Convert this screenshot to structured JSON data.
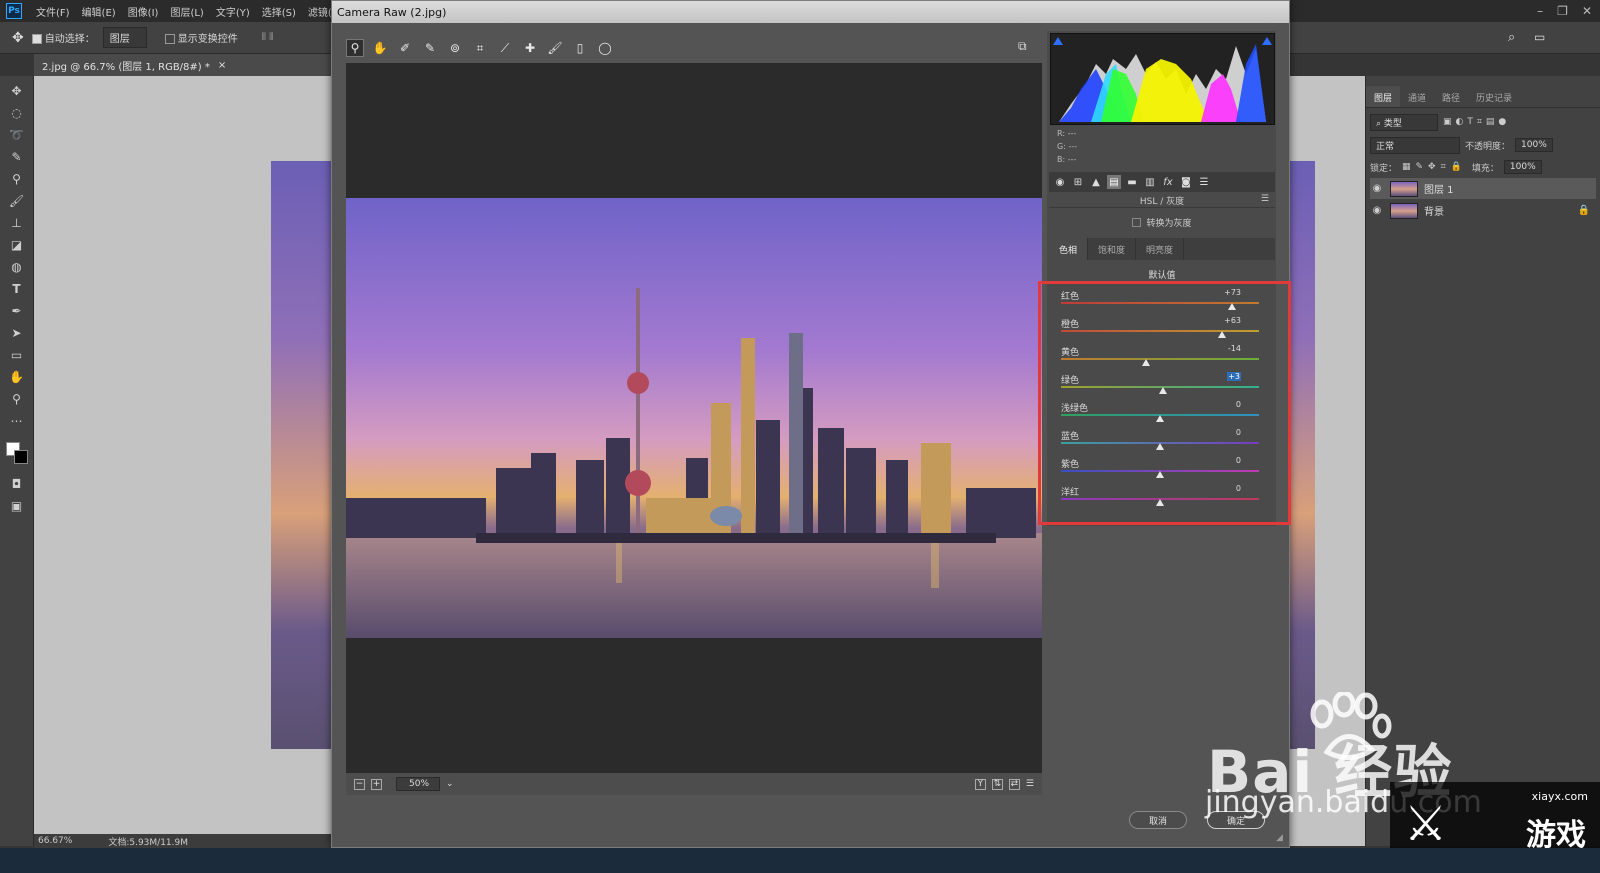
{
  "ps": {
    "logo": "Ps",
    "menu": [
      "文件(F)",
      "编辑(E)",
      "图像(I)",
      "图层(L)",
      "文字(Y)",
      "选择(S)",
      "滤镜(T)"
    ],
    "options": {
      "auto_select_label": "自动选择：",
      "auto_select_value": "图层",
      "show_transform_label": "显示变换控件"
    },
    "doc_tab": "2.jpg @ 66.7% (图层 1, RGB/8#) *",
    "status": {
      "zoom": "66.67%",
      "doc": "文档:5.93M/11.9M"
    },
    "layers_panel": {
      "tabs": [
        "图层",
        "通道",
        "路径",
        "历史记录"
      ],
      "filter_kind": "类型",
      "blend_mode": "正常",
      "opacity_label": "不透明度：",
      "opacity_value": "100%",
      "lock_label": "锁定：",
      "fill_label": "填充：",
      "fill_value": "100%",
      "layers": [
        {
          "name": "图层 1",
          "selected": true
        },
        {
          "name": "背景",
          "selected": false
        }
      ]
    }
  },
  "camera_raw": {
    "title": "Camera Raw (2.jpg)",
    "rgb": {
      "r_label": "R:",
      "g_label": "G:",
      "b_label": "B:",
      "r": "---",
      "g": "---",
      "b": "---"
    },
    "panel_title": "HSL / 灰度",
    "convert_gray_label": "转换为灰度",
    "tabs": [
      "色相",
      "饱和度",
      "明亮度"
    ],
    "active_tab": "色相",
    "default_label": "默认值",
    "sliders": [
      {
        "label": "红色",
        "value": "+73",
        "level": 0.865,
        "colors": [
          "#c03a3a",
          "#c07a30"
        ]
      },
      {
        "label": "橙色",
        "value": "+63",
        "level": 0.815,
        "colors": [
          "#c04a3a",
          "#c0a030"
        ]
      },
      {
        "label": "黄色",
        "value": "-14",
        "level": 0.43,
        "colors": [
          "#c07a30",
          "#6ab03a"
        ]
      },
      {
        "label": "绿色",
        "value": "+3",
        "level": 0.515,
        "highlight": true,
        "colors": [
          "#a0a030",
          "#30b090"
        ]
      },
      {
        "label": "浅绿色",
        "value": "0",
        "level": 0.5,
        "colors": [
          "#30a060",
          "#3090c0"
        ]
      },
      {
        "label": "蓝色",
        "value": "0",
        "level": 0.5,
        "colors": [
          "#3aa0a0",
          "#7a3ac0"
        ]
      },
      {
        "label": "紫色",
        "value": "0",
        "level": 0.5,
        "colors": [
          "#3a50c0",
          "#c03ab0"
        ]
      },
      {
        "label": "洋红",
        "value": "0",
        "level": 0.5,
        "colors": [
          "#8a3ac0",
          "#c03a5a"
        ]
      }
    ],
    "zoom": "50%",
    "cancel_label": "取消",
    "ok_label": "确定"
  },
  "watermark": {
    "brand": "Bai  经验",
    "url": "jingyan.baidu.com",
    "corner_url": "xiayx.com",
    "corner_game": "游戏"
  },
  "colors": {
    "highlight_box": "#e23a3a",
    "accent_blue": "#2d6db6"
  }
}
